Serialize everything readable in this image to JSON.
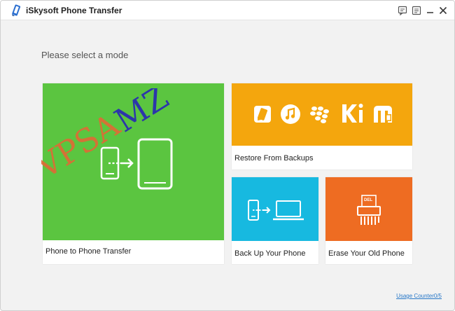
{
  "app": {
    "title": "iSkysoft Phone Transfer"
  },
  "subtitle": "Please select a mode",
  "tiles": {
    "phone_transfer": {
      "label": "Phone to Phone Transfer",
      "color": "#5bc540"
    },
    "restore": {
      "label": "Restore From Backups",
      "color": "#f4a60d"
    },
    "backup": {
      "label": "Back Up Your Phone",
      "color": "#17b9e0"
    },
    "erase": {
      "label": "Erase Your Old Phone",
      "color": "#ee6c22"
    }
  },
  "restore_icons": [
    "itunes-backup-icon",
    "music-icon",
    "blackberry-icon",
    "kies-icon",
    "mobiletrans-icon"
  ],
  "erase_badge": "DEL",
  "usage_counter": "Usage Counter0/5",
  "watermark": {
    "line1": "VPSA",
    "line2": "MZ"
  }
}
